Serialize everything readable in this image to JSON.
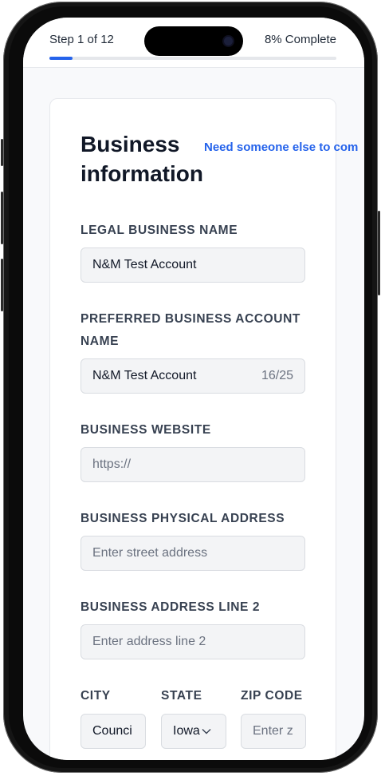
{
  "progress": {
    "step_text": "Step 1 of 12",
    "percent_text": "8% Complete",
    "percent_value": 0.08,
    "accent": "#2563eb"
  },
  "form": {
    "title": "Business information",
    "help_link": "Need someone else to com",
    "legal_name": {
      "label": "LEGAL BUSINESS NAME",
      "value": "N&M Test Account"
    },
    "preferred_name": {
      "label": "PREFERRED BUSINESS ACCOUNT NAME",
      "value": "N&M Test Account",
      "counter": "16/25"
    },
    "website": {
      "label": "BUSINESS WEBSITE",
      "placeholder": "https://"
    },
    "address": {
      "label": "BUSINESS PHYSICAL ADDRESS",
      "placeholder": "Enter street address"
    },
    "address2": {
      "label": "BUSINESS ADDRESS LINE 2",
      "placeholder": "Enter address line 2"
    },
    "city": {
      "label": "CITY",
      "value": "Counci"
    },
    "state": {
      "label": "STATE",
      "value": "Iowa",
      "icon": "chevron-down-icon"
    },
    "zip": {
      "label": "ZIP CODE",
      "placeholder": "Enter z"
    }
  }
}
